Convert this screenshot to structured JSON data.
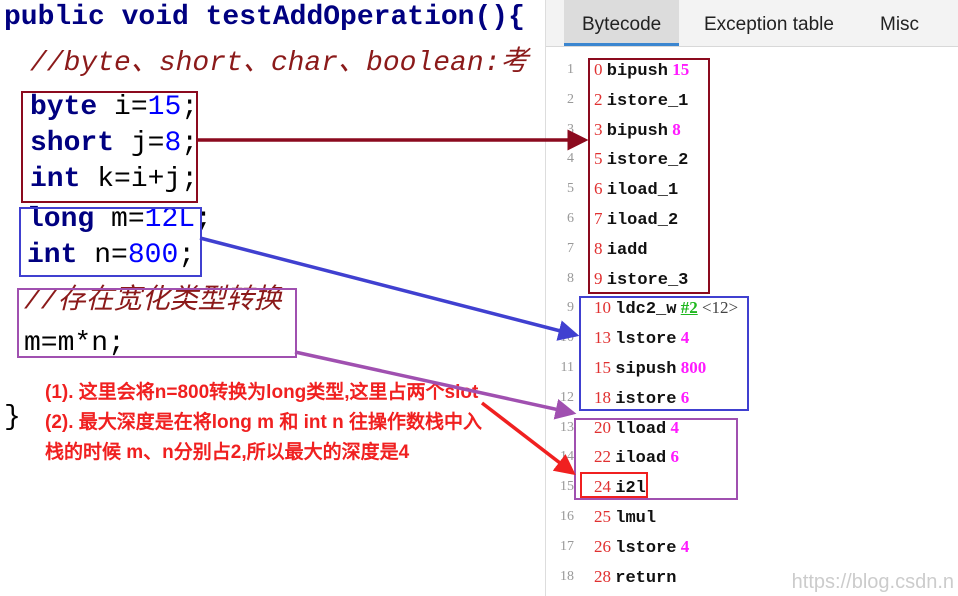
{
  "code": {
    "signature": "public void testAddOperation(){",
    "comment1": "//byte、short、char、boolean:考",
    "line_byte": {
      "kw": "byte",
      "rest": " i=",
      "num": "15",
      "end": ";"
    },
    "line_short": {
      "kw": "short",
      "rest": " j=",
      "num": "8",
      "end": ";"
    },
    "line_int_k": {
      "kw": "int",
      "rest": " k=i+j;"
    },
    "line_long": {
      "kw": "long",
      "rest": " m=",
      "num": "12L",
      "end": ";"
    },
    "line_int_n": {
      "kw": "int",
      "rest": " n=",
      "num": "800",
      "end": ";"
    },
    "comment2": "//存在宽化类型转换",
    "line_mul": "m=m*n;",
    "close_brace": "}"
  },
  "annotation": {
    "line1": "(1). 这里会将n=800转换为long类型,这里占两个slot",
    "line2": "(2). 最大深度是在将long m 和 int n 往操作数栈中入栈的时候 m、n分别占2,所以最大的深度是4"
  },
  "panel": {
    "tabs": [
      {
        "label": "Bytecode",
        "active": true
      },
      {
        "label": "Exception table"
      },
      {
        "label": "Misc"
      }
    ],
    "rows": [
      {
        "ln": "1",
        "off": "0",
        "ins": "bipush",
        "arg": "15"
      },
      {
        "ln": "2",
        "off": "2",
        "ins": "istore_1"
      },
      {
        "ln": "3",
        "off": "3",
        "ins": "bipush",
        "arg": "8"
      },
      {
        "ln": "4",
        "off": "5",
        "ins": "istore_2"
      },
      {
        "ln": "5",
        "off": "6",
        "ins": "iload_1"
      },
      {
        "ln": "6",
        "off": "7",
        "ins": "iload_2"
      },
      {
        "ln": "7",
        "off": "8",
        "ins": "iadd"
      },
      {
        "ln": "8",
        "off": "9",
        "ins": "istore_3"
      },
      {
        "ln": "9",
        "off": "10",
        "ins": "ldc2_w",
        "ref": "#2",
        "comment": "<12>"
      },
      {
        "ln": "10",
        "off": "13",
        "ins": "lstore",
        "arg": "4"
      },
      {
        "ln": "11",
        "off": "15",
        "ins": "sipush",
        "arg": "800"
      },
      {
        "ln": "12",
        "off": "18",
        "ins": "istore",
        "arg": "6"
      },
      {
        "ln": "13",
        "off": "20",
        "ins": "lload",
        "arg": "4"
      },
      {
        "ln": "14",
        "off": "22",
        "ins": "iload",
        "arg": "6"
      },
      {
        "ln": "15",
        "off": "24",
        "ins": "i2l"
      },
      {
        "ln": "16",
        "off": "25",
        "ins": "lmul"
      },
      {
        "ln": "17",
        "off": "26",
        "ins": "lstore",
        "arg": "4"
      },
      {
        "ln": "18",
        "off": "28",
        "ins": "return"
      }
    ]
  },
  "watermark": "https://blog.csdn.n",
  "colors": {
    "darkred": "#8b0a1e",
    "blue": "#4040d0",
    "purple": "#a050b0",
    "red": "#f02020"
  }
}
